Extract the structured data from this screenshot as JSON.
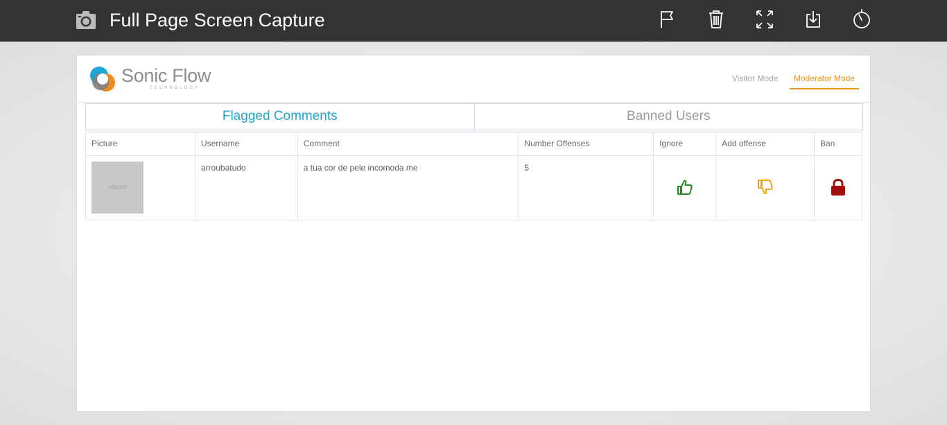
{
  "capture_bar": {
    "title": "Full Page Screen Capture",
    "icons": [
      "camera-icon",
      "flag-icon",
      "trash-icon",
      "expand-icon",
      "download-icon",
      "timer-icon"
    ]
  },
  "site": {
    "logo_name": "Sonic Flow",
    "logo_sub": "TECHNOLOGY",
    "modes": {
      "visitor": "Visitor Mode",
      "moderator": "Moderator Mode",
      "active": "Moderator Mode"
    }
  },
  "tabs": [
    {
      "label": "Flagged Comments",
      "active": true
    },
    {
      "label": "Banned Users",
      "active": false
    }
  ],
  "table": {
    "headers": [
      "Picture",
      "Username",
      "Comment",
      "Number Offenses",
      "Ignore",
      "Add offense",
      "Ban"
    ],
    "rows": [
      {
        "picture_placeholder": "100x100",
        "username": "arroubatudo",
        "comment": "a tua cor de pele incomoda me",
        "offenses": "5",
        "ignore_icon": "thumbs-up-icon",
        "add_offense_icon": "thumbs-down-icon",
        "ban_icon": "lock-icon"
      }
    ]
  },
  "colors": {
    "capture_bar": "#333333",
    "tab_active": "#22a3c9",
    "moderator_accent": "#f0921e",
    "ignore": "#1e8a1e",
    "add_offense": "#f2a312",
    "ban": "#a31010"
  }
}
